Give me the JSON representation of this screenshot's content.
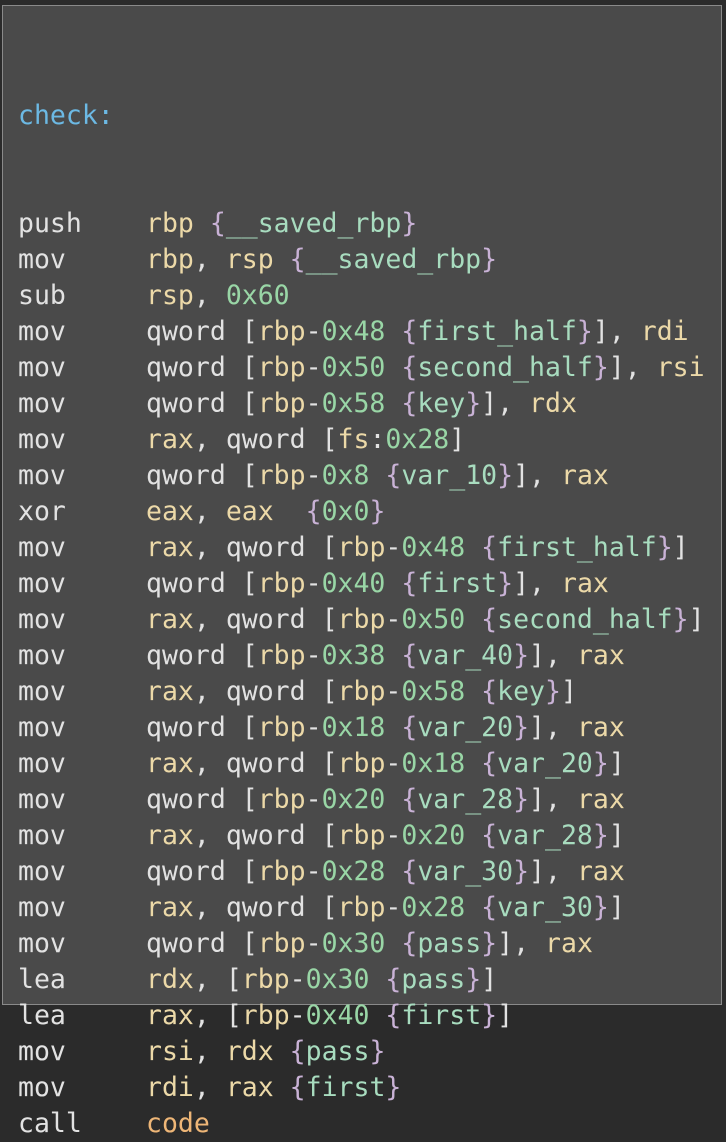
{
  "function_label": "check:",
  "colors": {
    "background": "#4a4a4a",
    "label": "#6cb9e4",
    "register": "#ecd9a8",
    "number": "#99d6a6",
    "brace": "#c9b2d6",
    "variable": "#a8dcbf",
    "function": "#eeb677"
  },
  "lines": [
    {
      "mnemonic": "push",
      "operands": "rbp {__saved_rbp}"
    },
    {
      "mnemonic": "mov",
      "operands": "rbp, rsp {__saved_rbp}"
    },
    {
      "mnemonic": "sub",
      "operands": "rsp, 0x60"
    },
    {
      "mnemonic": "mov",
      "operands": "qword [rbp-0x48 {first_half}], rdi"
    },
    {
      "mnemonic": "mov",
      "operands": "qword [rbp-0x50 {second_half}], rsi"
    },
    {
      "mnemonic": "mov",
      "operands": "qword [rbp-0x58 {key}], rdx"
    },
    {
      "mnemonic": "mov",
      "operands": "rax, qword [fs:0x28]"
    },
    {
      "mnemonic": "mov",
      "operands": "qword [rbp-0x8 {var_10}], rax"
    },
    {
      "mnemonic": "xor",
      "operands": "eax, eax  {0x0}"
    },
    {
      "mnemonic": "mov",
      "operands": "rax, qword [rbp-0x48 {first_half}]"
    },
    {
      "mnemonic": "mov",
      "operands": "qword [rbp-0x40 {first}], rax"
    },
    {
      "mnemonic": "mov",
      "operands": "rax, qword [rbp-0x50 {second_half}]"
    },
    {
      "mnemonic": "mov",
      "operands": "qword [rbp-0x38 {var_40}], rax"
    },
    {
      "mnemonic": "mov",
      "operands": "rax, qword [rbp-0x58 {key}]"
    },
    {
      "mnemonic": "mov",
      "operands": "qword [rbp-0x18 {var_20}], rax"
    },
    {
      "mnemonic": "mov",
      "operands": "rax, qword [rbp-0x18 {var_20}]"
    },
    {
      "mnemonic": "mov",
      "operands": "qword [rbp-0x20 {var_28}], rax"
    },
    {
      "mnemonic": "mov",
      "operands": "rax, qword [rbp-0x20 {var_28}]"
    },
    {
      "mnemonic": "mov",
      "operands": "qword [rbp-0x28 {var_30}], rax"
    },
    {
      "mnemonic": "mov",
      "operands": "rax, qword [rbp-0x28 {var_30}]"
    },
    {
      "mnemonic": "mov",
      "operands": "qword [rbp-0x30 {pass}], rax"
    },
    {
      "mnemonic": "lea",
      "operands": "rdx, [rbp-0x30 {pass}]"
    },
    {
      "mnemonic": "lea",
      "operands": "rax, [rbp-0x40 {first}]"
    },
    {
      "mnemonic": "mov",
      "operands": "rsi, rdx {pass}"
    },
    {
      "mnemonic": "mov",
      "operands": "rdi, rax {first}"
    },
    {
      "mnemonic": "call",
      "operands": "code"
    }
  ]
}
